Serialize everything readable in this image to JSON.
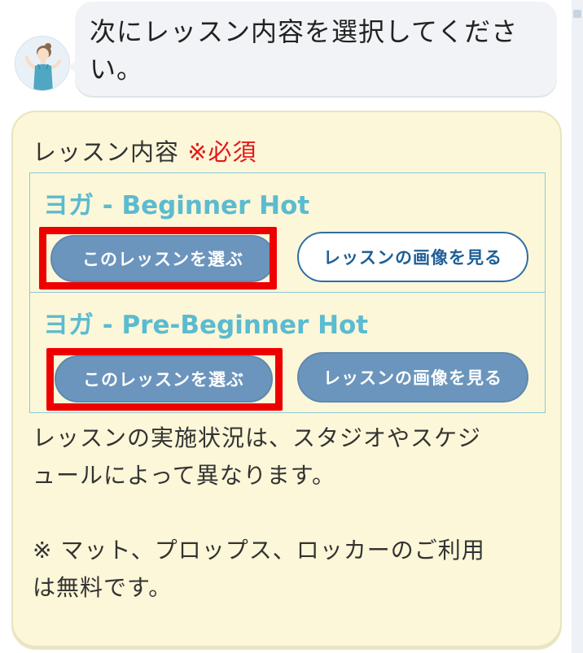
{
  "chat": {
    "message_line1": "次にレッスン内容を選択してくださ",
    "message_line2": "い。"
  },
  "form": {
    "label": "レッスン内容",
    "required_mark": "※必須",
    "lessons": [
      {
        "title": "ヨガ - Beginner Hot",
        "select_label": "このレッスンを選ぶ",
        "image_label": "レッスンの画像を見る"
      },
      {
        "title": "ヨガ - Pre-Beginner Hot",
        "select_label": "このレッスンを選ぶ",
        "image_label": "レッスンの画像を見る"
      }
    ],
    "note_line1": "レッスンの実施状況は、スタジオやスケジ",
    "note_line2": "ュールによって異なります。",
    "note_line3": "※ マット、プロップス、ロッカーのご利用",
    "note_line4": "は無料です。"
  },
  "colors": {
    "accent_title": "#5bbbd0",
    "button_fill": "#6b95bd",
    "button_outline": "#2e6ea5",
    "card_background": "#fcf7d8",
    "highlight": "#ee0000",
    "required": "#e31919"
  },
  "icons": {
    "avatar": "instructor-avatar-icon"
  }
}
